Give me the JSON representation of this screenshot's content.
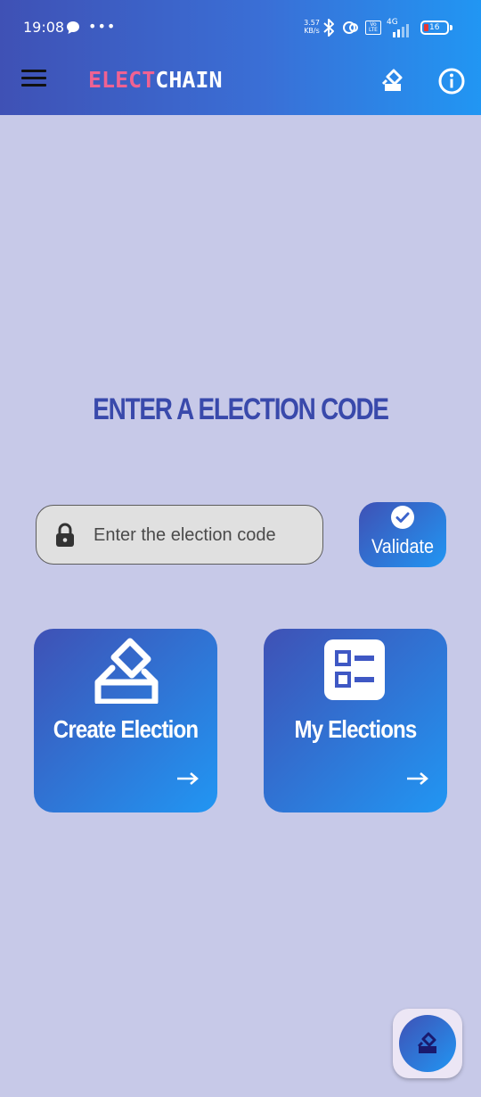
{
  "status_bar": {
    "time": "19:08",
    "more": "•••",
    "net_speed": "3.57 KB/s",
    "volte": "Vo LTE",
    "network": "4G",
    "battery": "16"
  },
  "app_bar": {
    "brand_part1": "ELECT",
    "brand_part2": "CHAIN",
    "icons": [
      "menu-icon",
      "ballot-icon",
      "info-icon"
    ]
  },
  "main": {
    "title": "ENTER A ELECTION CODE",
    "code_input": {
      "value": "",
      "placeholder": "Enter the election code"
    },
    "validate_label": "Validate",
    "cards": [
      {
        "label": "Create Election",
        "icon": "ballot-box-icon",
        "arrow": "→"
      },
      {
        "label": "My Elections",
        "icon": "checklist-icon",
        "arrow": "→"
      }
    ]
  },
  "colors": {
    "background": "#c7c9e8",
    "gradient_start": "#3f51b5",
    "gradient_end": "#2196f3",
    "brand_accent": "#f06292",
    "title": "#3949ab"
  }
}
